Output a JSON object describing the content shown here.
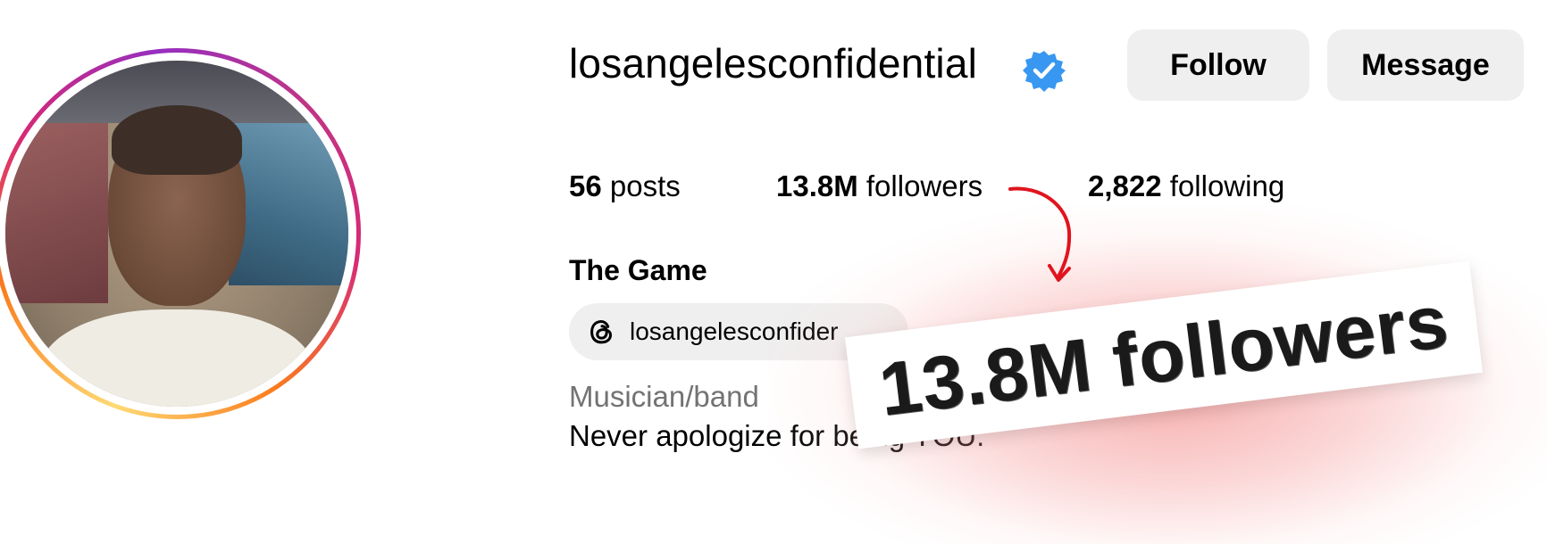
{
  "profile": {
    "username": "losangelesconfidential",
    "verified": true,
    "full_name": "The Game",
    "threads_handle": "losangelesconfider",
    "category": "Musician/band",
    "bio": "Never apologize for being YOU."
  },
  "actions": {
    "follow_label": "Follow",
    "message_label": "Message"
  },
  "stats": {
    "posts_count": "56",
    "posts_label": "posts",
    "followers_count": "13.8M",
    "followers_label": "followers",
    "following_count": "2,822",
    "following_label": "following"
  },
  "annotation": {
    "zoom_text": "13.8M followers",
    "arrow_color": "#e0141e",
    "glow_color": "#f07070"
  },
  "colors": {
    "button_bg": "#efefef",
    "verified_blue": "#3897f0",
    "muted_text": "#737373"
  },
  "icons": {
    "verified": "verified-badge-icon",
    "threads": "threads-icon"
  }
}
